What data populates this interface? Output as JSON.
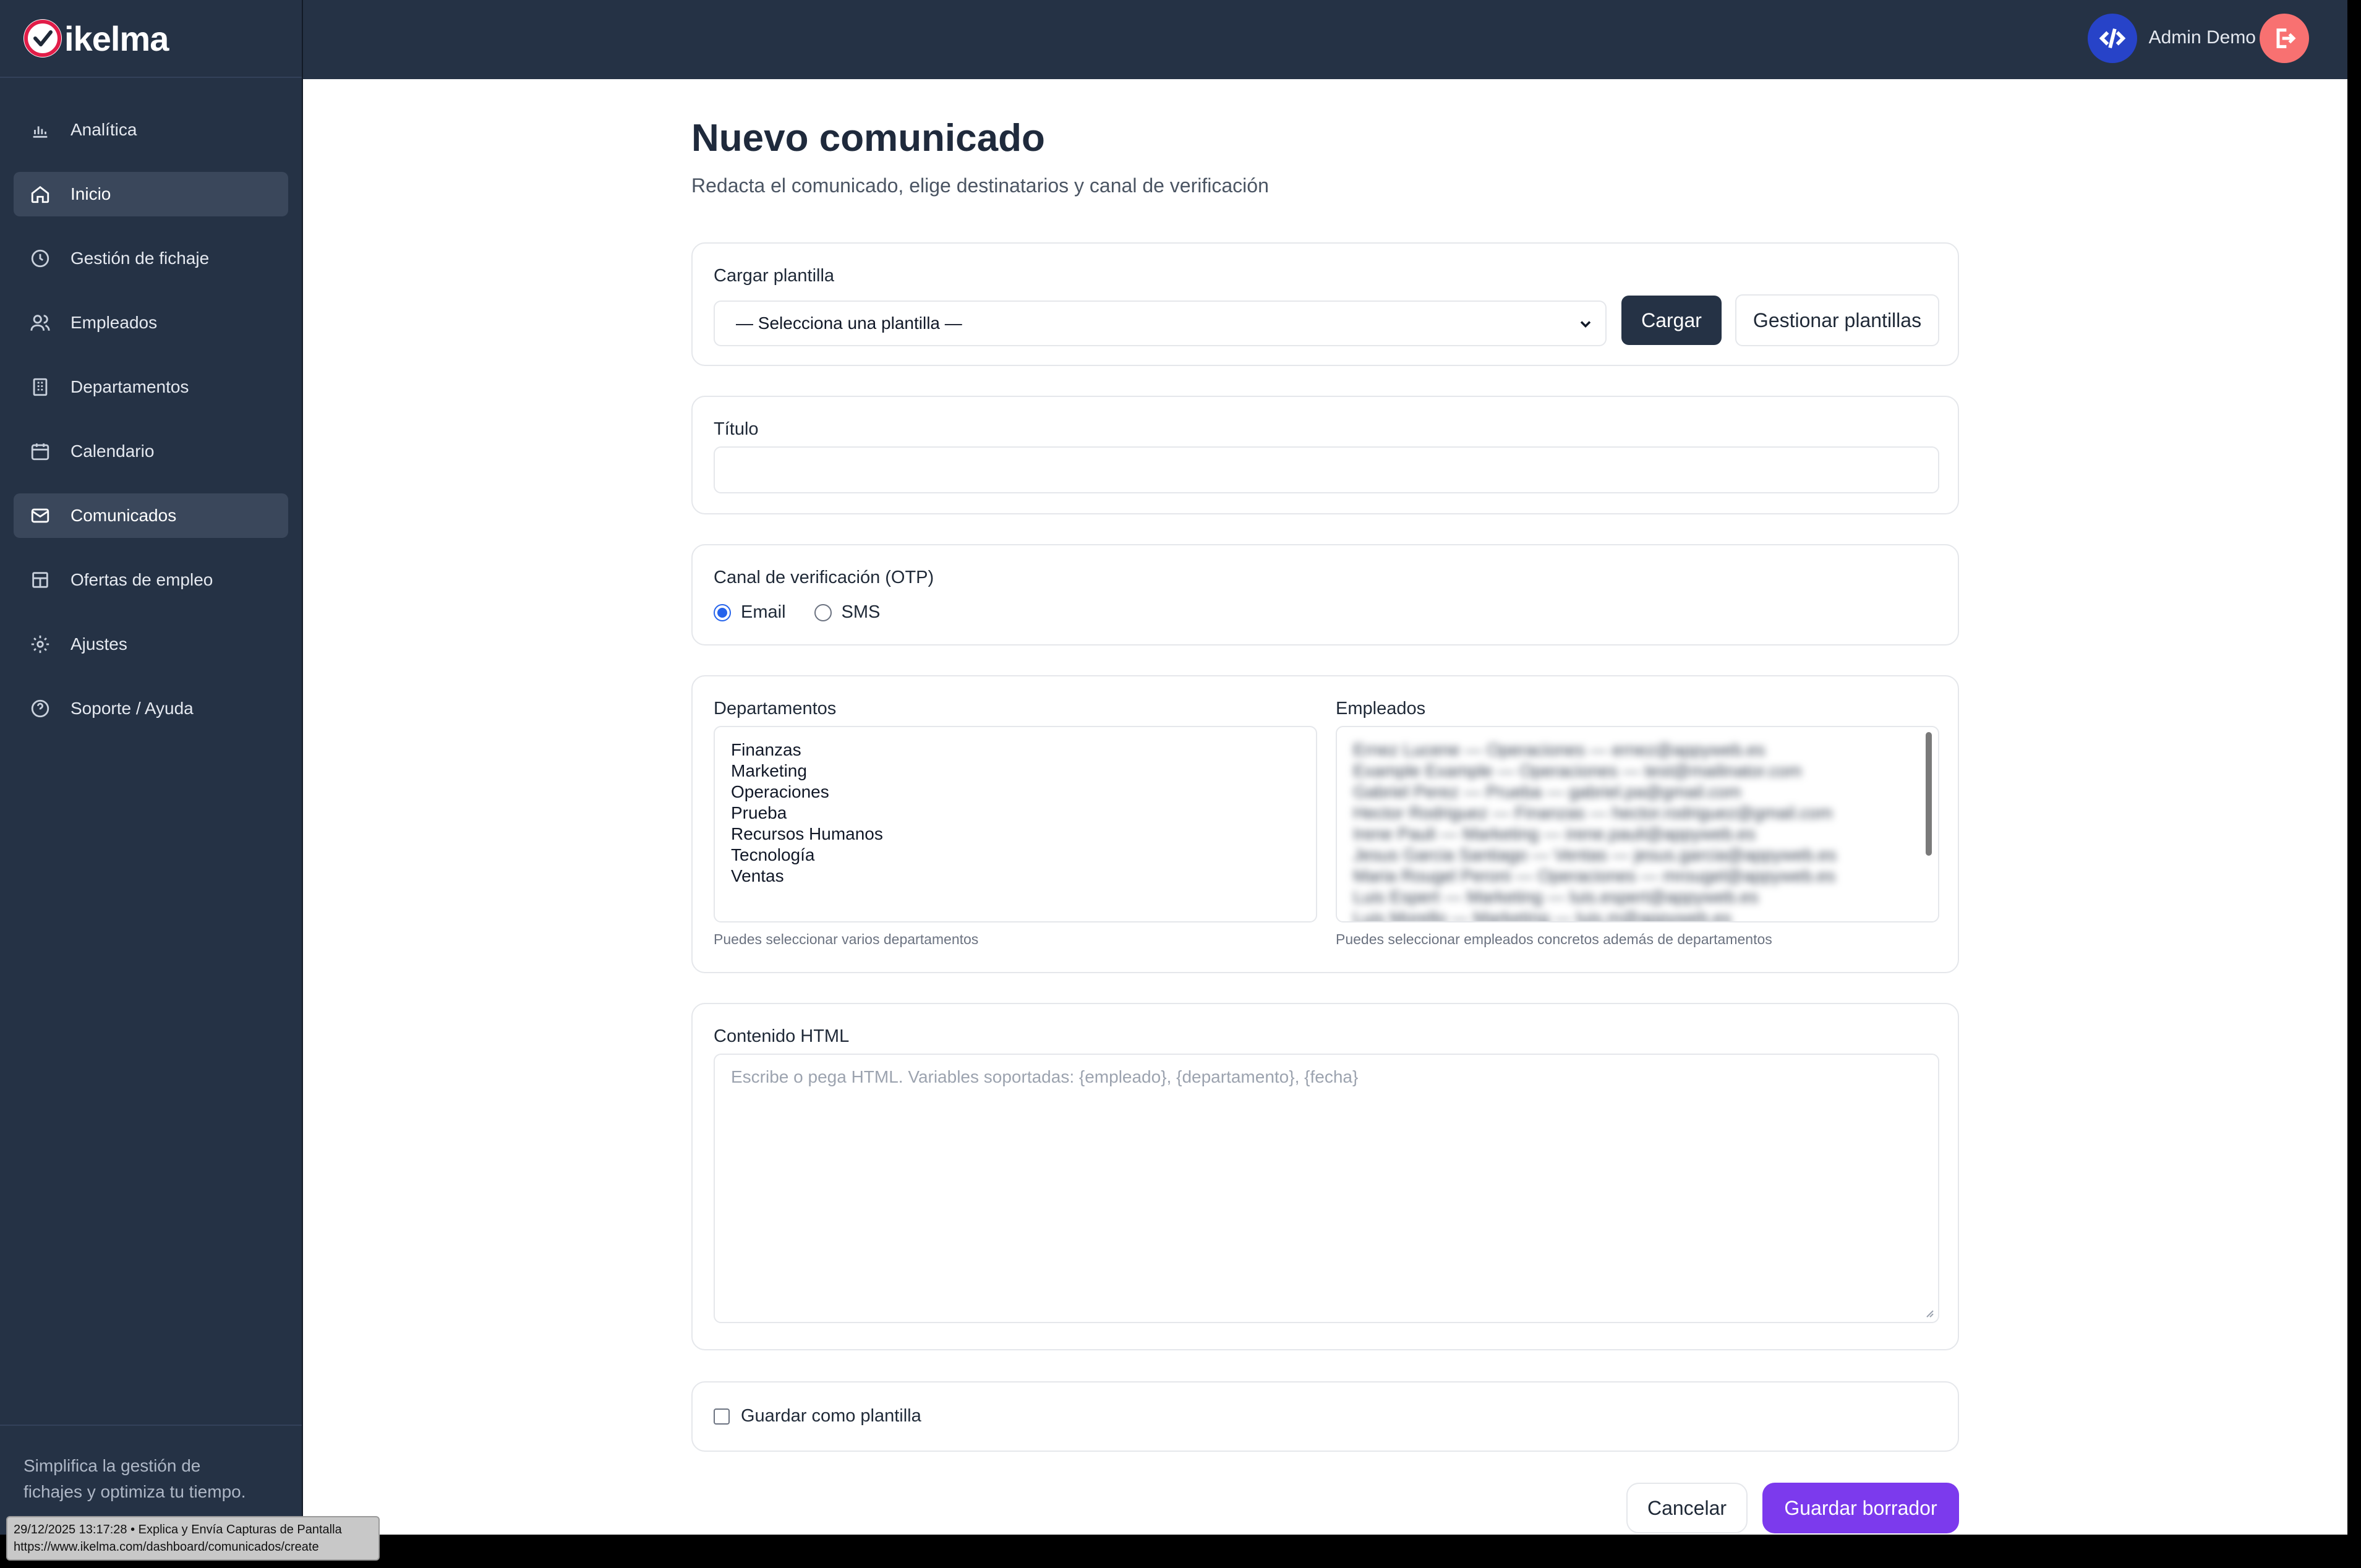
{
  "brand": {
    "name": "ikelma"
  },
  "sidebar": {
    "items": [
      {
        "label": "Analítica",
        "icon": "chart-icon"
      },
      {
        "label": "Inicio",
        "icon": "home-icon",
        "active": true
      },
      {
        "label": "Gestión de fichaje",
        "icon": "clock-icon"
      },
      {
        "label": "Empleados",
        "icon": "users-icon"
      },
      {
        "label": "Departamentos",
        "icon": "building-icon"
      },
      {
        "label": "Calendario",
        "icon": "calendar-icon"
      },
      {
        "label": "Comunicados",
        "icon": "mail-icon",
        "active": true
      },
      {
        "label": "Ofertas de empleo",
        "icon": "briefcase-icon"
      },
      {
        "label": "Ajustes",
        "icon": "gear-icon"
      },
      {
        "label": "Soporte / Ayuda",
        "icon": "help-icon"
      }
    ],
    "footer_line1": "Simplifica la gestión de",
    "footer_line2": "fichajes y optimiza tu tiempo."
  },
  "topbar": {
    "user_name": "Admin Demo"
  },
  "page": {
    "title": "Nuevo comunicado",
    "subtitle": "Redacta el comunicado, elige destinatarios y canal de verificación"
  },
  "template_card": {
    "label": "Cargar plantilla",
    "select_value": "— Selecciona una plantilla —",
    "load_button": "Cargar",
    "manage_button": "Gestionar plantillas"
  },
  "title_card": {
    "label": "Título",
    "value": ""
  },
  "otp_card": {
    "label": "Canal de verificación (OTP)",
    "options": [
      {
        "label": "Email",
        "selected": true
      },
      {
        "label": "SMS",
        "selected": false
      }
    ]
  },
  "recipients": {
    "departments_label": "Departamentos",
    "departments": [
      "Finanzas",
      "Marketing",
      "Operaciones",
      "Prueba",
      "Recursos Humanos",
      "Tecnología",
      "Ventas"
    ],
    "departments_hint": "Puedes seleccionar varios departamentos",
    "employees_label": "Empleados",
    "employees": [
      "Ernez Lucene — Operaciones — ernez@appyweb.es",
      "Example Example — Operaciones — test@mailinator.com",
      "Gabriel Perez — Prueba — gabriel.pa@gmail.com",
      "Hector Rodriguez — Finanzas — hector.rodriguez@gmail.com",
      "Irene Pauli — Marketing — irene.pauli@appyweb.es",
      "Jesus Garcia Santiago — Ventas — jesus.garcia@appyweb.es",
      "Maria Rougel Peroni — Operaciones — mrougel@appyweb.es",
      "Luis Espert — Marketing — luis.espert@appyweb.es",
      "Luis Morello — Marketing — luis.m@appyweb.es"
    ],
    "employees_hint": "Puedes seleccionar empleados concretos además de departamentos"
  },
  "content_card": {
    "label": "Contenido HTML",
    "placeholder": "Escribe o pega HTML. Variables soportadas: {empleado}, {departamento}, {fecha}"
  },
  "save_template": {
    "label": "Guardar como plantilla",
    "checked": false
  },
  "actions": {
    "cancel": "Cancelar",
    "save_draft": "Guardar borrador"
  },
  "status_overlay": {
    "line1": "29/12/2025 13:17:28 • Explica y Envía Capturas de Pantalla",
    "line2": "https://www.ikelma.com/dashboard/comunicados/create"
  },
  "colors": {
    "sidebar": "#253245",
    "primary": "#7c3aed",
    "accent_blue": "#2743c8",
    "logout": "#f87171",
    "brand_red": "#e11d48"
  }
}
